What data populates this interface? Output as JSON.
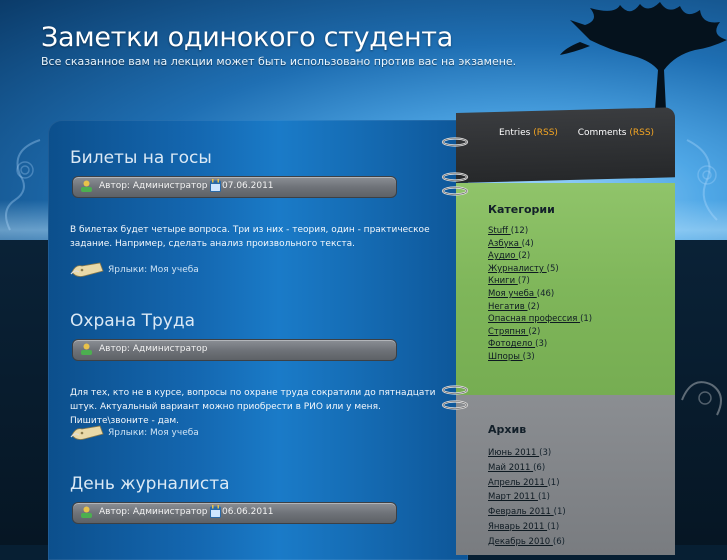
{
  "header": {
    "title": "Заметки одинокого студента",
    "subtitle": "Все сказанное вам на лекции может быть использовано против вас на экзамене."
  },
  "feeds": {
    "entries_label": "Entries",
    "comments_label": "Comments",
    "rss_label": "(RSS)"
  },
  "posts": [
    {
      "title": "Билеты на госы",
      "author": "Автор: Администратор",
      "date": "07.06.2011",
      "text": "В билетах будет четыре вопроса. Три из них - теория, один - практическое задание. Например, сделать анализ произвольного текста.",
      "tags": "Ярлыки: Моя учеба"
    },
    {
      "title": "Охрана Труда",
      "author": "Автор: Администратор",
      "date": "",
      "text": "Для тех, кто не в курсе, вопросы по охране труда сократили до пятнадцати штук. Актуальный вариант можно приобрести в РИО или у меня. Пишите\\звоните - дам.",
      "tags": "Ярлыки: Моя учеба"
    },
    {
      "title": "День журналиста",
      "author": "Автор: Администратор",
      "date": "06.06.2011",
      "text": "",
      "tags": ""
    }
  ],
  "categories": {
    "title": "Категории",
    "items": [
      {
        "label": "Stuff ",
        "count": "(12)"
      },
      {
        "label": "Азбука ",
        "count": "(4)"
      },
      {
        "label": "Аудио ",
        "count": "(2)"
      },
      {
        "label": "Журналисту ",
        "count": "(5)"
      },
      {
        "label": "Книги ",
        "count": "(7)"
      },
      {
        "label": "Моя учеба ",
        "count": "(46)"
      },
      {
        "label": "Негатив ",
        "count": "(2)"
      },
      {
        "label": "Опасная профессия ",
        "count": "(1)"
      },
      {
        "label": "Стряпня ",
        "count": "(2)"
      },
      {
        "label": "Фотодело ",
        "count": "(3)"
      },
      {
        "label": "Шпоры ",
        "count": "(3)"
      }
    ]
  },
  "archive": {
    "title": "Архив",
    "items": [
      {
        "label": "Июнь 2011 ",
        "count": "(3)"
      },
      {
        "label": "Май 2011 ",
        "count": "(6)"
      },
      {
        "label": "Апрель 2011 ",
        "count": "(1)"
      },
      {
        "label": "Март 2011 ",
        "count": "(1)"
      },
      {
        "label": "Февраль 2011 ",
        "count": "(1)"
      },
      {
        "label": "Январь 2011 ",
        "count": "(1)"
      },
      {
        "label": "Декабрь 2010 ",
        "count": "(6)"
      }
    ]
  },
  "colors": {
    "rss": "#f5a623",
    "sidebar_green": "#84bb5e",
    "panel_blue": "#1467b0"
  }
}
